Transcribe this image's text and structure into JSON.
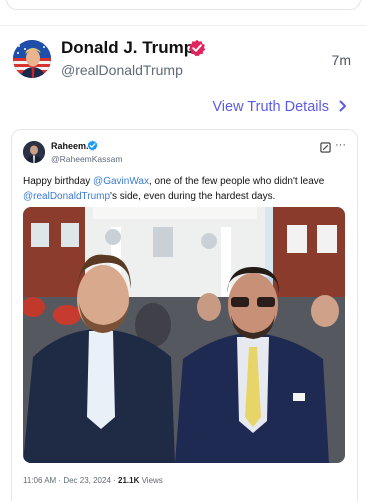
{
  "post": {
    "author_name": "Donald J. Trump",
    "author_handle": "@realDonaldTrump",
    "time_ago": "7m",
    "details_link": "View Truth Details"
  },
  "quote": {
    "name": "Raheem.",
    "handle": "@RaheemKassam",
    "text_before": "Happy birthday ",
    "mention_1": "@GavinWax",
    "text_middle": ", one of the few people who didn't leave ",
    "mention_2": "@realDonaldTrump",
    "text_after": "'s side, even during the hardest days.",
    "timestamp": "11:06 AM · Dec 23, 2024 · ",
    "views_count": "21.1K",
    "views_label": " Views"
  },
  "colors": {
    "verified_badge": "#e0245e",
    "quote_verified_badge": "#1d9bf0",
    "link": "#5b5be6",
    "mention": "#3a7bd5"
  },
  "icons": [
    "verified-badge-icon",
    "chevron-right-icon",
    "grok-icon",
    "more-icon"
  ]
}
